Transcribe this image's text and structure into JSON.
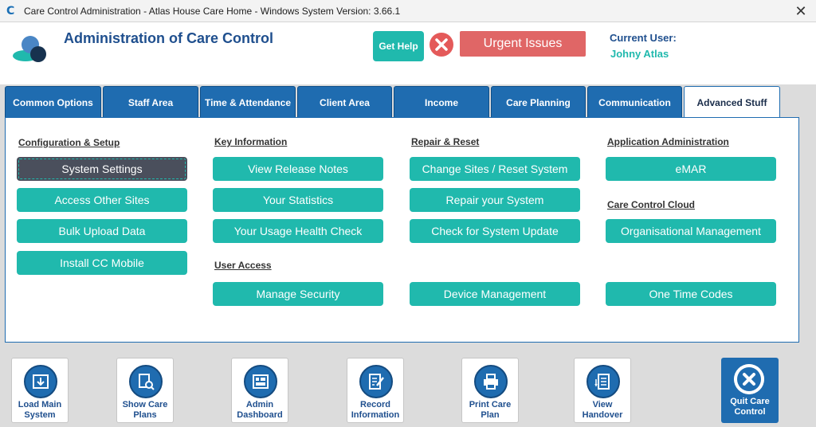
{
  "window": {
    "title": "Care Control Administration - Atlas House Care Home - Windows System Version: 3.66.1",
    "logo_letter": "C",
    "close_glyph": "✕"
  },
  "header": {
    "title": "Administration of Care Control",
    "help_label": "Get Help",
    "urgent_label": "Urgent Issues",
    "current_user_label": "Current User:",
    "current_user_name": "Johny Atlas"
  },
  "tabs": [
    {
      "label": "Common Options"
    },
    {
      "label": "Staff Area"
    },
    {
      "label": "Time & Attendance"
    },
    {
      "label": "Client Area"
    },
    {
      "label": "Income"
    },
    {
      "label": "Care Planning"
    },
    {
      "label": "Communication"
    },
    {
      "label": "Advanced Stuff"
    }
  ],
  "sections": {
    "config": {
      "heading": "Configuration & Setup",
      "buttons": [
        "System Settings",
        "Access Other Sites",
        "Bulk Upload Data",
        "Install CC Mobile"
      ]
    },
    "key_info": {
      "heading": "Key Information",
      "buttons": [
        "View Release Notes",
        "Your Statistics",
        "Your Usage Health Check"
      ]
    },
    "user_access": {
      "heading": "User Access",
      "buttons": [
        "Manage Security"
      ]
    },
    "repair": {
      "heading": "Repair & Reset",
      "buttons": [
        "Change Sites / Reset System",
        "Repair your System",
        "Check for System Update",
        "Device Management"
      ]
    },
    "app_admin": {
      "heading": "Application Administration",
      "buttons": [
        "eMAR"
      ]
    },
    "cloud": {
      "heading": "Care Control Cloud",
      "buttons": [
        "Organisational Management",
        "One Time Codes"
      ]
    }
  },
  "bottom": [
    {
      "line1": "Load Main",
      "line2": "System",
      "icon": "download-box-icon"
    },
    {
      "line1": "Show Care",
      "line2": "Plans",
      "icon": "document-search-icon"
    },
    {
      "line1": "Admin",
      "line2": "Dashboard",
      "icon": "dashboard-icon"
    },
    {
      "line1": "Record",
      "line2": "Information",
      "icon": "edit-document-icon"
    },
    {
      "line1": "Print Care",
      "line2": "Plan",
      "icon": "printer-icon"
    },
    {
      "line1": "View",
      "line2": "Handover",
      "icon": "list-icon"
    }
  ],
  "quit": {
    "line1": "Quit Care",
    "line2": "Control"
  },
  "colors": {
    "teal": "#20b9ad",
    "blue": "#1f6cb0",
    "navy": "#1f4f8e",
    "urgent": "#e06666",
    "selected": "#4a4f5c"
  }
}
